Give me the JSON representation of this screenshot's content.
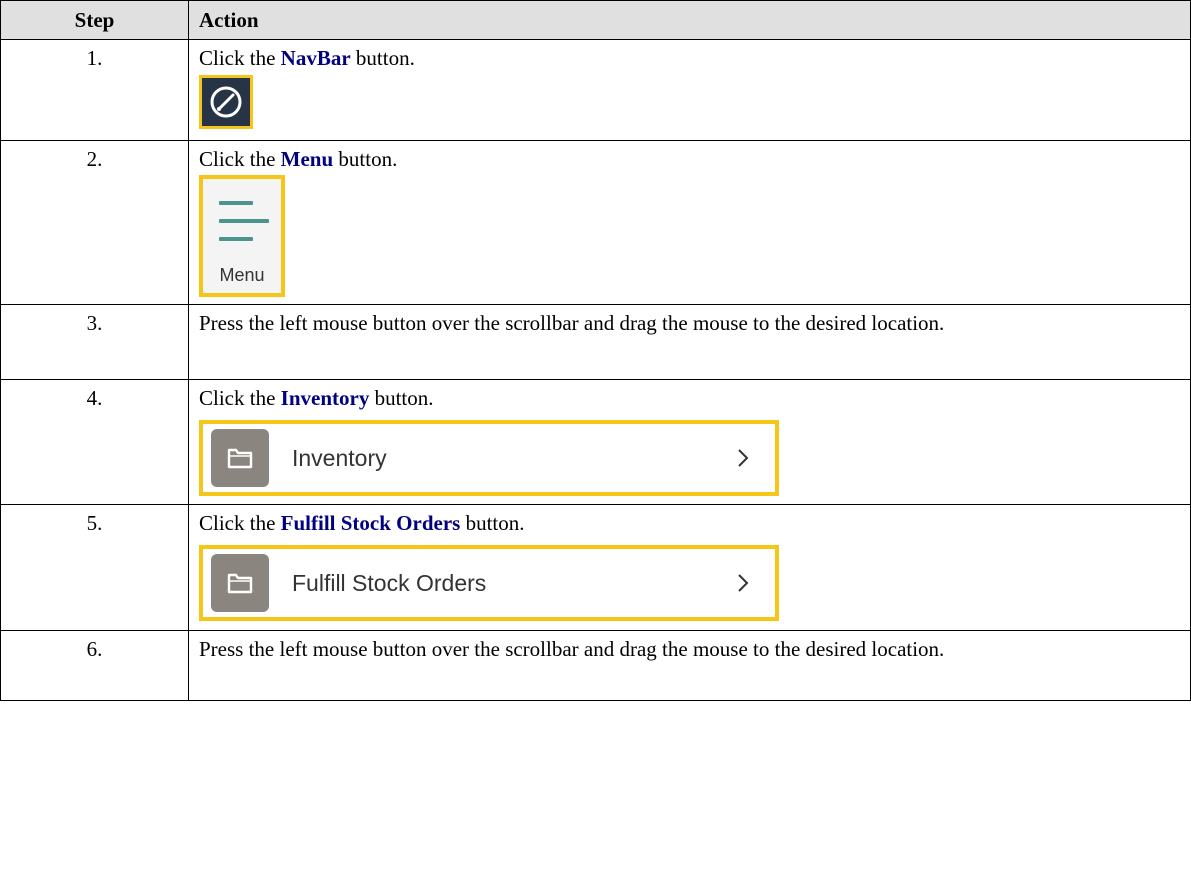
{
  "header": {
    "step": "Step",
    "action": "Action"
  },
  "steps": [
    {
      "num": "1.",
      "pre": "Click the ",
      "kw": "NavBar",
      "post": " button.",
      "visual": "navbar-icon"
    },
    {
      "num": "2.",
      "pre": "Click the ",
      "kw": "Menu",
      "post": " button.",
      "visual": "menu-icon",
      "visual_label": "Menu"
    },
    {
      "num": "3.",
      "text": "Press the left mouse button over the scrollbar and drag the mouse to the desired location."
    },
    {
      "num": "4.",
      "pre": "Click the ",
      "kw": "Inventory",
      "post": " button.",
      "visual": "folder-icon",
      "visual_label": "Inventory"
    },
    {
      "num": "5.",
      "pre": "Click the ",
      "kw": "Fulfill Stock Orders",
      "post": " button.",
      "visual": "folder-icon",
      "visual_label": "Fulfill Stock Orders"
    },
    {
      "num": "6.",
      "text": "Press the left mouse button over the scrollbar and drag the mouse to the desired location."
    }
  ],
  "colors": {
    "highlight": "#f5c518",
    "keyword": "#000080",
    "navbar_bg": "#263445",
    "menu_bar": "#4d938e",
    "folder": "#8b8580"
  }
}
